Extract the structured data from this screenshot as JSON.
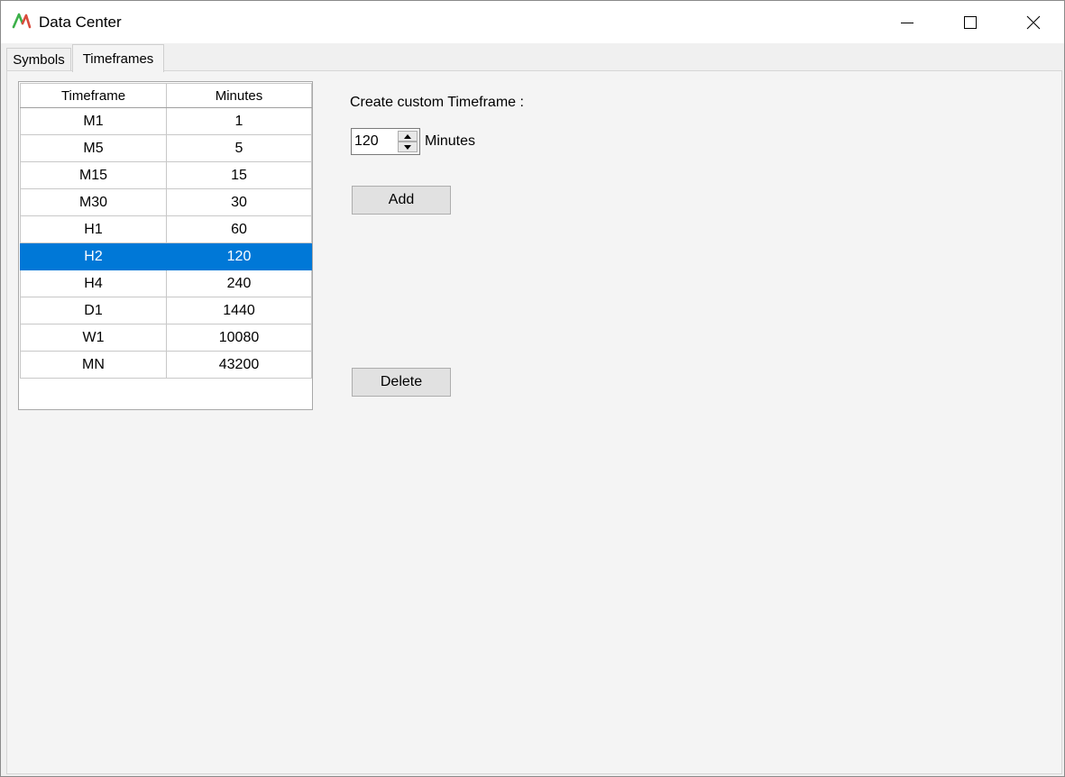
{
  "window": {
    "title": "Data Center",
    "brand_color": "#3cb04a",
    "accent_color": "#d94b3c"
  },
  "tabs": [
    {
      "label": "Symbols",
      "active": false
    },
    {
      "label": "Timeframes",
      "active": true
    }
  ],
  "timeframes": {
    "columns": [
      "Timeframe",
      "Minutes"
    ],
    "rows": [
      {
        "name": "M1",
        "minutes": "1"
      },
      {
        "name": "M5",
        "minutes": "5"
      },
      {
        "name": "M15",
        "minutes": "15"
      },
      {
        "name": "M30",
        "minutes": "30"
      },
      {
        "name": "H1",
        "minutes": "60"
      },
      {
        "name": "H2",
        "minutes": "120"
      },
      {
        "name": "H4",
        "minutes": "240"
      },
      {
        "name": "D1",
        "minutes": "1440"
      },
      {
        "name": "W1",
        "minutes": "10080"
      },
      {
        "name": "MN",
        "minutes": "43200"
      }
    ],
    "selected_index": 5,
    "selection_color": "#0078d7"
  },
  "custom": {
    "label": "Create custom Timeframe :",
    "value": "120",
    "unit": "Minutes",
    "add_label": "Add",
    "delete_label": "Delete"
  }
}
